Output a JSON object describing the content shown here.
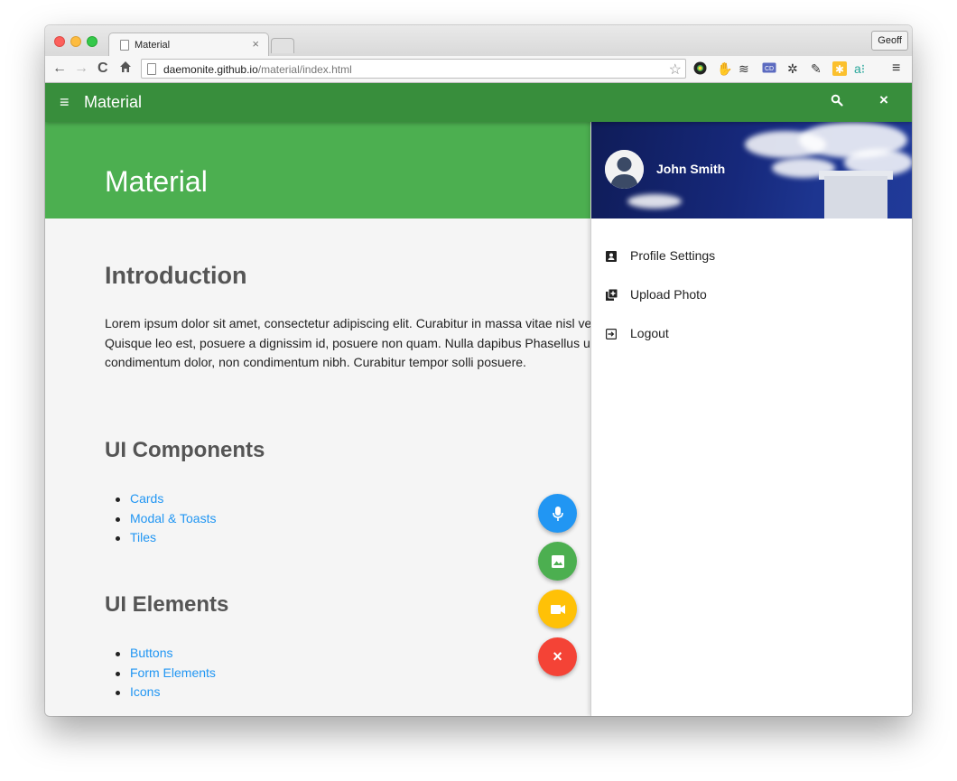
{
  "browser": {
    "tab_title": "Material",
    "tab_close": "×",
    "profile_name": "Geoff",
    "url_host": "daemonite.github.io",
    "url_path": "/material/index.html",
    "extension_icons": [
      "chrome-icon",
      "hand-icon",
      "layers-icon",
      "cd-icon",
      "gear-icon",
      "pencil-icon",
      "star-badge-icon",
      "amazon-icon",
      "menu-icon"
    ]
  },
  "appbar": {
    "title": "Material",
    "menu_icon": "≡",
    "close_icon": "×"
  },
  "hero": {
    "title": "Material"
  },
  "content": {
    "intro_heading": "Introduction",
    "intro_text": "Lorem ipsum dolor sit amet, consectetur adipiscing elit. Curabitur in massa vitae nisl vel purus. Quisque leo est, posuere a dignissim id, posuere non quam. Nulla dapibus Phasellus ultrices condimentum dolor, non condimentum nibh. Curabitur tempor solli posuere.",
    "ui_components_heading": "UI Components",
    "ui_components_links": [
      "Cards",
      "Modal & Toasts",
      "Tiles"
    ],
    "ui_elements_heading": "UI Elements",
    "ui_elements_links": [
      "Buttons",
      "Form Elements",
      "Icons"
    ]
  },
  "fabs": {
    "colors": {
      "mic": "#2196f3",
      "image": "#4caf50",
      "video": "#ffc107",
      "close": "#f44336"
    },
    "close_label": "×"
  },
  "drawer": {
    "user_name": "John Smith",
    "items": [
      {
        "label": "Profile Settings",
        "icon": "account-box-icon"
      },
      {
        "label": "Upload Photo",
        "icon": "add-photo-icon"
      },
      {
        "label": "Logout",
        "icon": "logout-icon"
      }
    ]
  },
  "colors": {
    "appbar": "#388e3c",
    "hero": "#4caf50",
    "link": "#2196f3"
  }
}
